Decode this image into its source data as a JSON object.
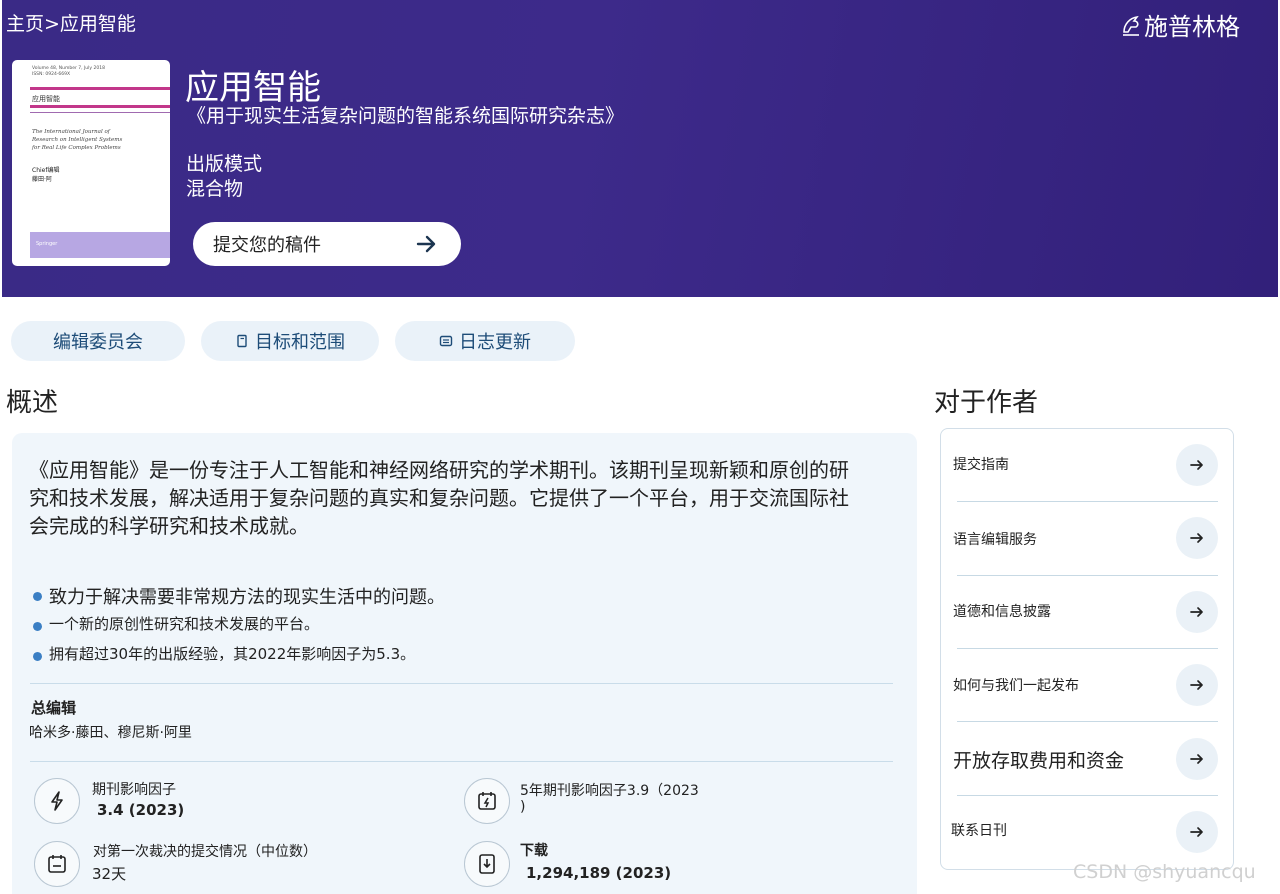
{
  "header": {
    "breadcrumb": "主页>应用智能",
    "brand": "施普林格",
    "journal_title": "应用智能",
    "journal_subtitle": "《用于现实生活复杂问题的智能系统国际研究杂志》",
    "publishing_mode_label": "出版模式",
    "publishing_mode_value": "混合物",
    "submit_button": "提交您的稿件"
  },
  "cover": {
    "volume_line": "Volume 48, Number 7, July 2018",
    "issn_line": "ISSN: 0924-669X",
    "title": "应用智能",
    "subtitle_line1": "The International Journal of",
    "subtitle_line2": "Research on Intelligent Systems",
    "subtitle_line3": "for Real Life Complex Problems",
    "editor_line1": "Chief编辑",
    "editor_line2": "藤田·阿",
    "publisher": "Springer"
  },
  "tabs": [
    "编辑委员会",
    "目标和范围",
    "日志更新"
  ],
  "overview": {
    "title": "概述",
    "description": "《应用智能》是一份专注于人工智能和神经网络研究的学术期刊。该期刊呈现新颖和原创的研究和技术发展，解决适用于复杂问题的真实和复杂问题。它提供了一个平台，用于交流国际社会完成的科学研究和技术成就。",
    "bullets": [
      "致力于解决需要非常规方法的现实生活中的问题。",
      "一个新的原创性研究和技术发展的平台。",
      "拥有超过30年的出版经验，其2022年影响因子为5.3。"
    ],
    "editor_label": "总编辑",
    "editor_names": "哈米多·藤田、穆尼斯·阿里",
    "metrics": {
      "impact_factor_label": "期刊影响因子",
      "impact_factor_value": "3.4 (2023)",
      "five_year_label": "5年期刊影响因子3.9（2023",
      "five_year_label_cont": ")",
      "first_decision_label": "对第一次裁决的提交情况（中位数）",
      "first_decision_value": "32天",
      "downloads_label": "下载",
      "downloads_value": "1,294,189 (2023)"
    }
  },
  "authors": {
    "title": "对于作者",
    "items": [
      "提交指南",
      "语言编辑服务",
      "道德和信息披露",
      "如何与我们一起发布",
      "开放存取费用和资金",
      "联系日刊"
    ]
  },
  "watermark": "CSDN @shyuancqu",
  "colors": {
    "header_bg": "#3a2a86",
    "tab_bg": "#eaf2f9",
    "card_bg": "#f0f6fb",
    "accent": "#1d4c78",
    "bullet": "#3b7fc4"
  }
}
